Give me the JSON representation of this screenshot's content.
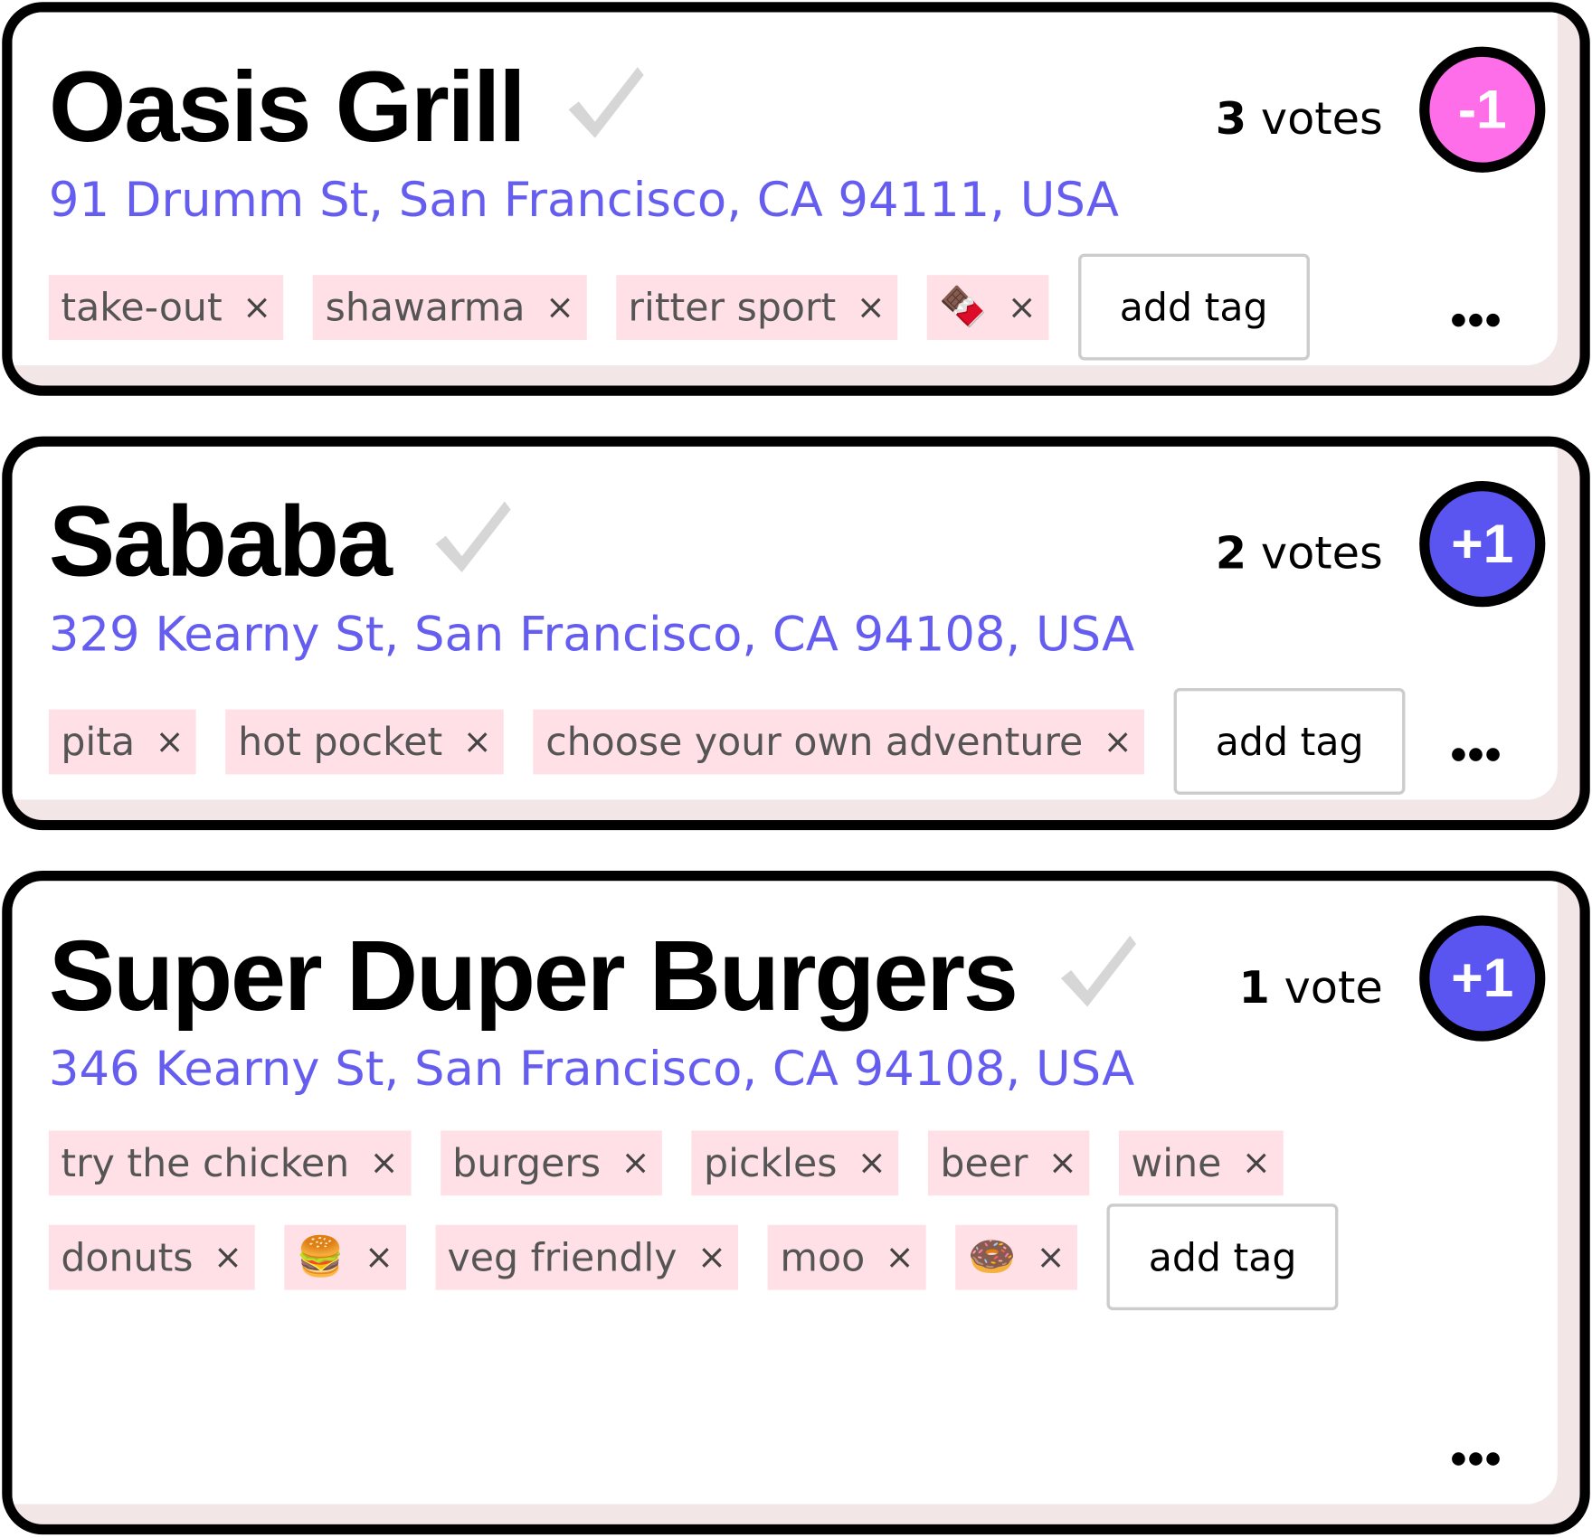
{
  "colors": {
    "address": "#655df0",
    "downvote": "#ff6ee9",
    "upvote": "#5a54f0",
    "tag_bg": "#ffe0e6",
    "check": "#d6d6d6"
  },
  "cards": [
    {
      "name": "Oasis Grill",
      "address": "91 Drumm St, San Francisco, CA 94111, USA",
      "vote_count": "3",
      "vote_unit": "votes",
      "vote_button": "-1",
      "vote_button_color": "#ff6ee9",
      "tags": [
        "take-out",
        "shawarma",
        "ritter sport",
        "🍫"
      ],
      "add_tag_label": "add tag",
      "more_icon": "more-dots-icon"
    },
    {
      "name": "Sababa",
      "address": "329 Kearny St, San Francisco, CA 94108, USA",
      "vote_count": "2",
      "vote_unit": "votes",
      "vote_button": "+1",
      "vote_button_color": "#5a54f0",
      "tags": [
        "pita",
        "hot pocket",
        "choose your own adventure"
      ],
      "add_tag_label": "add tag",
      "more_icon": "more-dots-icon"
    },
    {
      "name": "Super Duper Burgers",
      "address": "346 Kearny St, San Francisco, CA 94108, USA",
      "vote_count": "1",
      "vote_unit": "vote",
      "vote_button": "+1",
      "vote_button_color": "#5a54f0",
      "tags": [
        "try the chicken",
        "burgers",
        "pickles",
        "beer",
        "wine",
        "donuts",
        "🍔",
        "veg friendly",
        "moo",
        "🍩"
      ],
      "add_tag_label": "add tag",
      "more_icon": "more-dots-icon"
    }
  ],
  "remove_tag_glyph": "×"
}
